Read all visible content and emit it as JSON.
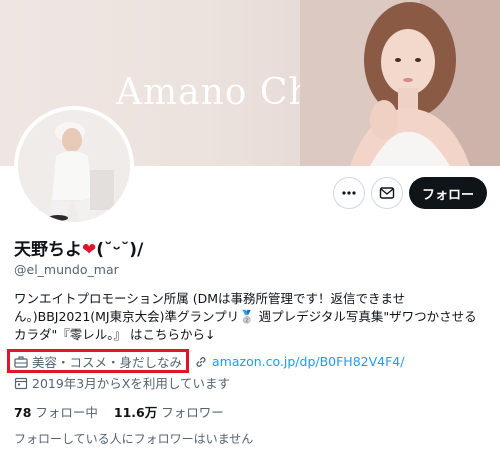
{
  "banner": {
    "text": "Amano Chiyo"
  },
  "actions": {
    "more_icon": "more-icon",
    "dm_icon": "mail-icon",
    "follow_label": "フォロー"
  },
  "profile": {
    "name": "天野ちよ",
    "name_suffix": "(˘ᵕ˘)/",
    "handle": "@el_mundo_mar",
    "bio_lines": [
      "ワンエイトプロモーション所属 (DMは事務所管理です！返信できませ",
      "ん。)BBJ2021(MJ東京大会)準グランプリ🥈 週プレデジタル写真集\"ザワつかさせる",
      "カラダ\"『零レル。』 はこちらから↓"
    ],
    "category": "美容・コスメ・身だしなみ",
    "link": "amazon.co.jp/dp/B0FH82V4F4/",
    "joined": "2019年3月からXを利用しています"
  },
  "stats": {
    "following_count": "78",
    "following_label": "フォロー中",
    "followers_count": "11.6万",
    "followers_label": "フォロワー"
  },
  "footer": {
    "mutual_text": "フォローしている人にフォロワーはいません"
  },
  "colors": {
    "highlight": "#e0142a",
    "link": "#1d9bf0",
    "follow_bg": "#0f1419",
    "heart": "#e0142a"
  }
}
